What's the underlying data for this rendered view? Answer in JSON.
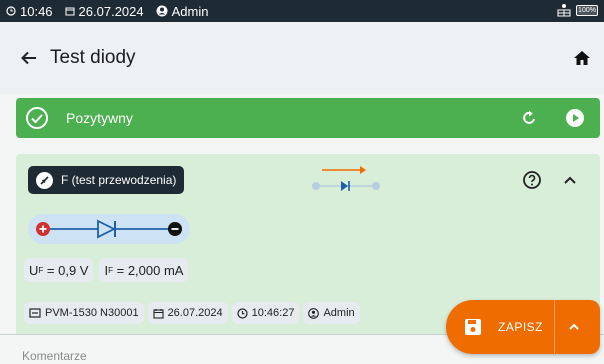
{
  "statusbar": {
    "time": "10:46",
    "date": "26.07.2024",
    "user": "Admin",
    "battery": "100%"
  },
  "appbar": {
    "title": "Test diody"
  },
  "result": {
    "label": "Pozytywny"
  },
  "card": {
    "mode_label": "F (test przewodzenia)",
    "params": {
      "voltage": "= 0,9 V",
      "current": "= 2,000 mA",
      "u_symbol": "U",
      "i_symbol": "I",
      "sub": "F"
    },
    "meta": {
      "device": "PVM-1530 N30001",
      "date": "26.07.2024",
      "time": "10:46:27",
      "user": "Admin"
    }
  },
  "comment": {
    "placeholder": "Komentarze"
  },
  "save": {
    "label": "ZAPISZ"
  },
  "colors": {
    "accent_green": "#4caf50",
    "card_bg": "#d9eed9",
    "save_orange": "#ef6c00",
    "dark": "#1e2a34"
  }
}
